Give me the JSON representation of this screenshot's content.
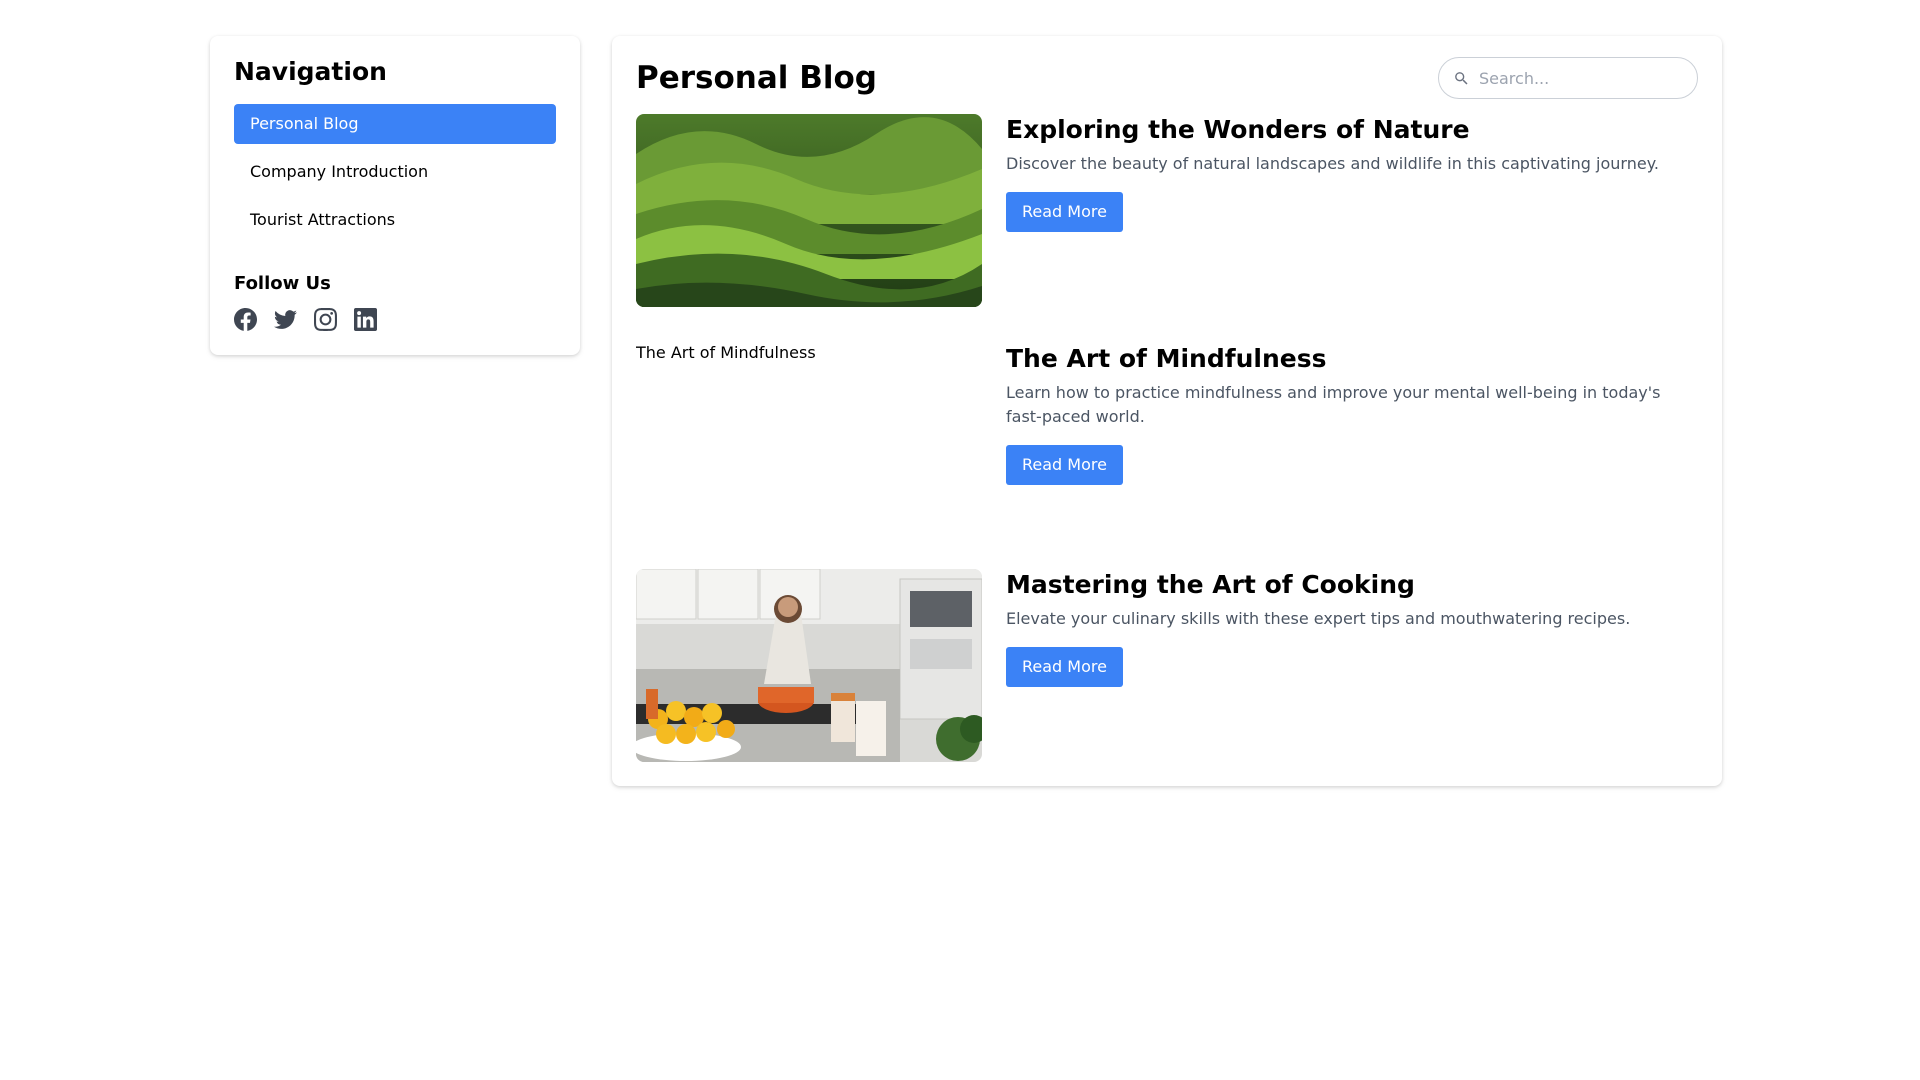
{
  "sidebar": {
    "title": "Navigation",
    "items": [
      {
        "label": "Personal Blog",
        "active": true
      },
      {
        "label": "Company Introduction",
        "active": false
      },
      {
        "label": "Tourist Attractions",
        "active": false
      }
    ],
    "follow_title": "Follow Us",
    "social_icons": [
      "facebook-icon",
      "twitter-icon",
      "instagram-icon",
      "linkedin-icon"
    ]
  },
  "main": {
    "title": "Personal Blog",
    "search": {
      "placeholder": "Search..."
    },
    "posts": [
      {
        "title": "Exploring the Wonders of Nature",
        "excerpt": "Discover the beauty of natural landscapes and wildlife in this captivating journey.",
        "button": "Read More",
        "image_alt": "Exploring the Wonders of Nature"
      },
      {
        "title": "The Art of Mindfulness",
        "excerpt": "Learn how to practice mindfulness and improve your mental well-being in today's fast-paced world.",
        "button": "Read More",
        "image_alt": "The Art of Mindfulness"
      },
      {
        "title": "Mastering the Art of Cooking",
        "excerpt": "Elevate your culinary skills with these expert tips and mouthwatering recipes.",
        "button": "Read More",
        "image_alt": "Mastering the Art of Cooking"
      }
    ]
  },
  "colors": {
    "accent": "#3b82f6",
    "muted_text": "#4b5563",
    "icon": "#3f4652"
  }
}
